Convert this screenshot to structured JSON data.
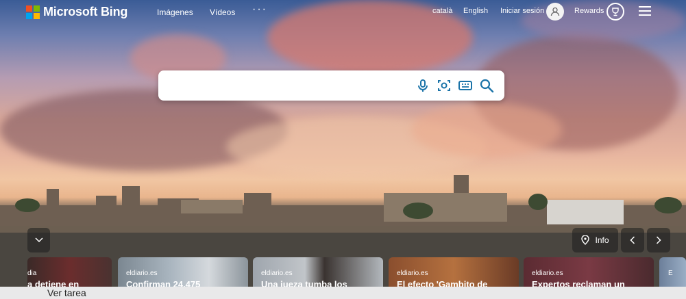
{
  "header": {
    "logo_text": "Microsoft Bing",
    "nav": [
      {
        "label": "Imágenes"
      },
      {
        "label": "Vídeos"
      },
      {
        "label": "···"
      }
    ],
    "languages": [
      "català",
      "English"
    ],
    "signin_label": "Iniciar sesión",
    "rewards_label": "Rewards"
  },
  "search": {
    "value": "",
    "placeholder": ""
  },
  "controls": {
    "info_label": "Info"
  },
  "news_cards": [
    {
      "source": "dia",
      "title": "a detiene en"
    },
    {
      "source": "eldiario.es",
      "title": "Confirman 24.475"
    },
    {
      "source": "eldiario.es",
      "title": "Una jueza tumba los"
    },
    {
      "source": "eldiario.es",
      "title": "El efecto 'Gambito de"
    },
    {
      "source": "eldiario.es",
      "title": "Expertos reclaman un"
    },
    {
      "source": "E",
      "title": ""
    }
  ],
  "taskbar": {
    "task_label": "Ver tarea"
  },
  "colors": {
    "logo_red": "#f25022",
    "logo_green": "#7fba00",
    "logo_blue": "#00a4ef",
    "logo_yellow": "#ffb900",
    "search_icon_blue": "#1a73a8"
  },
  "icons": [
    "microphone-icon",
    "visual-search-icon",
    "keyboard-icon",
    "search-icon",
    "user-icon",
    "rewards-trophy-icon",
    "hamburger-menu-icon",
    "chevron-down-icon",
    "location-pin-icon",
    "chevron-left-icon",
    "chevron-right-icon"
  ]
}
